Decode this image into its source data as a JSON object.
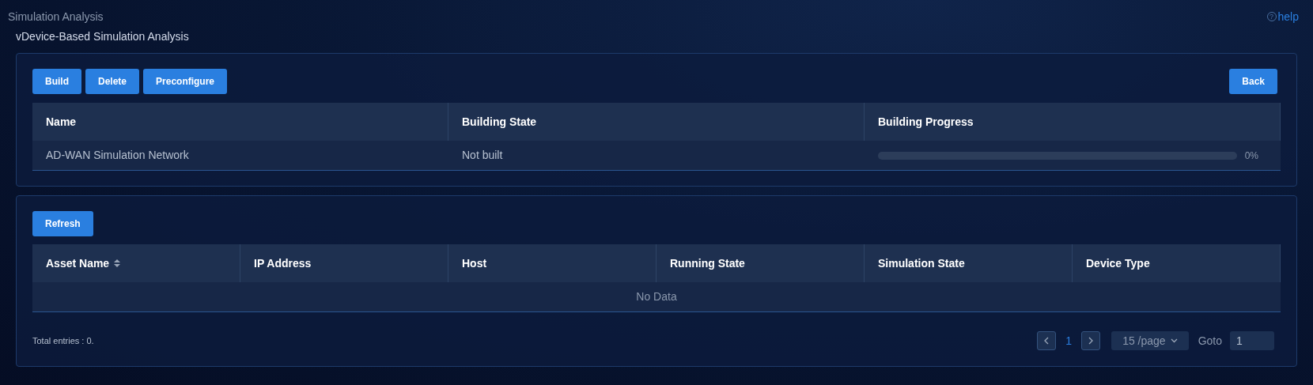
{
  "page_title": "Simulation Analysis",
  "help_link": {
    "icon": "?",
    "label": "help"
  },
  "section_title": "vDevice-Based Simulation Analysis",
  "build_panel": {
    "buttons": [
      "Build",
      "Delete",
      "Preconfigure"
    ],
    "back_button": "Back",
    "table": {
      "columns": [
        "Name",
        "Building State",
        "Building Progress"
      ],
      "rows": [
        {
          "name": "AD-WAN Simulation Network",
          "state": "Not built",
          "progress": {
            "level": 0,
            "reading": "0%"
          }
        }
      ]
    }
  },
  "asset_panel": {
    "refresh_button": "Refresh",
    "table": {
      "columns": [
        {
          "label": "Asset Name",
          "sortable": true
        },
        {
          "label": "IP Address",
          "sortable": false
        },
        {
          "label": "Host",
          "sortable": false
        },
        {
          "label": "Running State",
          "sortable": false
        },
        {
          "label": "Simulation State",
          "sortable": false
        },
        {
          "label": "Device Type",
          "sortable": false
        }
      ],
      "empty_text": "No Data"
    },
    "total_entries": "Total entries : 0.",
    "pagination": {
      "pages": [
        {
          "label": "1",
          "selected": true
        }
      ],
      "page_size": "15 /page",
      "goto_label": "Goto",
      "goto_value": "1"
    }
  }
}
